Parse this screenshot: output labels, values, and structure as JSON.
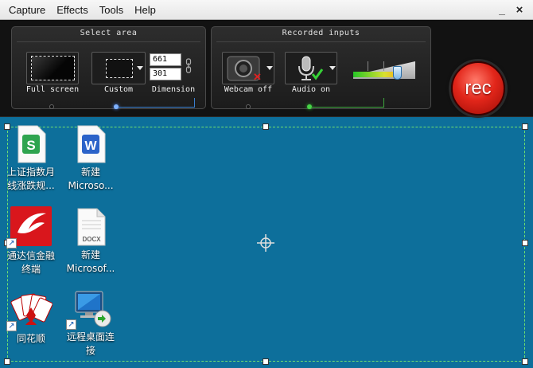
{
  "menu": {
    "items": [
      "Capture",
      "Effects",
      "Tools",
      "Help"
    ],
    "minimize": "_",
    "close": "×"
  },
  "select_area": {
    "title": "Select area",
    "full_screen": "Full screen",
    "custom": "Custom",
    "dimension": "Dimension",
    "width": "661",
    "height": "301"
  },
  "recorded_inputs": {
    "title": "Recorded inputs",
    "webcam": "Webcam off",
    "audio": "Audio on",
    "volume_level": 0.72
  },
  "rec": {
    "label": "rec"
  },
  "desktop": {
    "icons": [
      {
        "label1": "上证指数月",
        "label2": "线涨跌规...",
        "icon": "wps-sheet-icon",
        "color": "#2ea44f"
      },
      {
        "label1": "新建",
        "label2": "Microso...",
        "icon": "word-doc-icon",
        "color": "#2b63c9"
      },
      {
        "label1": "通达信金融",
        "label2": "终端",
        "icon": "tdx-app-icon",
        "color": "#d9161c"
      },
      {
        "label1": "新建",
        "label2": "Microsof...",
        "icon": "docx-file-icon",
        "color": "#777777",
        "badge": "DOCX"
      },
      {
        "label1": "同花顺",
        "label2": "",
        "icon": "tonghuashun-icon",
        "color": "#cc1111"
      },
      {
        "label1": "远程桌面连",
        "label2": "接",
        "icon": "remote-desktop-icon",
        "color": "#1f74c9"
      }
    ]
  }
}
